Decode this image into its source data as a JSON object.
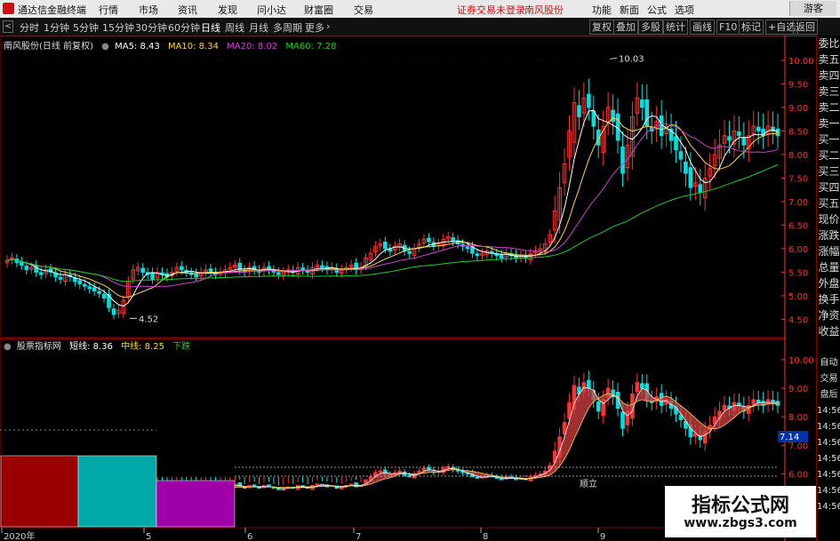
{
  "menubar": {
    "app_title": "通达信金融终端",
    "menu": [
      "行情",
      "市场",
      "资讯",
      "发现",
      "问小达",
      "财富圈",
      "交易"
    ],
    "notice": "证券交易未登录",
    "notice_stock": "南风股份",
    "right": [
      "功能",
      "新面",
      "公式",
      "选项"
    ],
    "guest": "游客"
  },
  "toolbar": {
    "periods": [
      "分时",
      "1分钟",
      "5分钟",
      "15分钟",
      "30分钟",
      "60分钟",
      "日线",
      "周线",
      "月线",
      "多周期",
      "更多"
    ],
    "active_period": "日线",
    "tools": [
      "复权",
      "叠加",
      "多股",
      "统计",
      "画线",
      "F10",
      "标记",
      "+自选",
      "返回"
    ]
  },
  "main_legend": {
    "stock": "南风股份(日线 前复权)",
    "ma5": "MA5: 8.43",
    "ma10": "MA10: 8.34",
    "ma20": "MA20: 8.02",
    "ma60": "MA60: 7.28"
  },
  "sub_legend": {
    "name": "股票指标网",
    "short": "短线: 8.36",
    "mid": "中线: 8.25",
    "signal": "下跌"
  },
  "colors": {
    "up": "#ff3232",
    "down": "#00e0e0",
    "ma5": "#ffffff",
    "ma10": "#ffd54a",
    "ma20": "#d040d0",
    "ma60": "#22cc22",
    "axis_red": "#ff3030",
    "ribbon": "#d04040"
  },
  "chart_data": {
    "type": "candlestick",
    "main_yaxis_ticks": [
      "10.00",
      "9.50",
      "9.00",
      "8.50",
      "8.00",
      "7.50",
      "7.00",
      "6.50",
      "6.00",
      "5.50",
      "5.00",
      "4.50"
    ],
    "main_ylim": [
      4.3,
      10.3
    ],
    "sub_yaxis_ticks": [
      "10.00",
      "9.00",
      "8.00",
      "7.00",
      "6.00"
    ],
    "sub_ylim": [
      5.8,
      10.4
    ],
    "annotations": {
      "high": "10.03",
      "low": "4.52",
      "sub_mark": "7.14",
      "sub_text": "顺立"
    },
    "x_labels": [
      "2020年",
      "5",
      "6",
      "7",
      "8",
      "9"
    ],
    "closes": [
      5.75,
      5.8,
      5.7,
      5.65,
      5.55,
      5.6,
      5.5,
      5.45,
      5.55,
      5.5,
      5.4,
      5.35,
      5.45,
      5.4,
      5.3,
      5.25,
      5.2,
      5.15,
      5.1,
      5.05,
      4.95,
      4.75,
      4.6,
      4.7,
      4.9,
      5.3,
      5.55,
      5.6,
      5.5,
      5.45,
      5.35,
      5.5,
      5.45,
      5.4,
      5.5,
      5.6,
      5.55,
      5.5,
      5.45,
      5.4,
      5.5,
      5.55,
      5.5,
      5.45,
      5.5,
      5.55,
      5.6,
      5.65,
      5.55,
      5.5,
      5.6,
      5.55,
      5.5,
      5.6,
      5.55,
      5.5,
      5.45,
      5.5,
      5.55,
      5.5,
      5.6,
      5.55,
      5.5,
      5.6,
      5.65,
      5.6,
      5.55,
      5.6,
      5.5,
      5.55,
      5.6,
      5.65,
      5.55,
      5.6,
      5.8,
      5.9,
      6.05,
      6.1,
      6.0,
      5.95,
      6.05,
      6.1,
      5.95,
      5.9,
      6.0,
      6.1,
      6.2,
      6.15,
      6.05,
      6.1,
      6.2,
      6.25,
      6.15,
      6.1,
      6.05,
      6.0,
      5.9,
      5.85,
      5.9,
      5.95,
      5.9,
      5.85,
      5.8,
      5.9,
      5.85,
      5.8,
      5.85,
      5.8,
      5.9,
      5.95,
      6.0,
      6.1,
      6.3,
      6.8,
      7.3,
      7.8,
      8.5,
      9.1,
      8.8,
      9.2,
      9.0,
      8.6,
      8.2,
      8.6,
      9.0,
      8.7,
      8.3,
      7.6,
      8.2,
      8.8,
      9.2,
      9.0,
      8.6,
      8.5,
      8.7,
      8.4,
      8.6,
      8.3,
      8.1,
      7.9,
      7.6,
      7.3,
      7.4,
      7.2,
      7.5,
      7.7,
      8.0,
      8.2,
      8.4,
      8.3,
      8.5,
      8.4,
      8.2,
      8.4,
      8.6,
      8.5,
      8.4,
      8.6,
      8.5,
      8.4
    ]
  }
}
